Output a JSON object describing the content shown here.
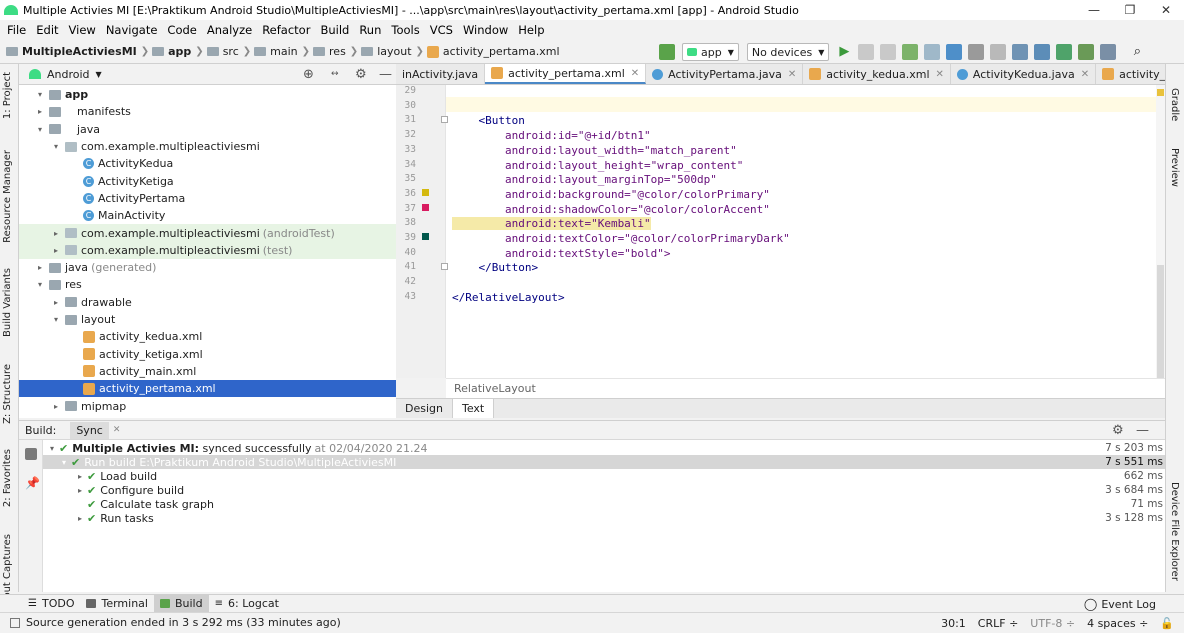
{
  "window": {
    "title": "Multiple Activies MI [E:\\Praktikum Android Studio\\MultipleActiviesMI] - ...\\app\\src\\main\\res\\layout\\activity_pertama.xml [app] - Android Studio",
    "min": "—",
    "max": "❐",
    "close": "✕"
  },
  "menu": [
    "File",
    "Edit",
    "View",
    "Navigate",
    "Code",
    "Analyze",
    "Refactor",
    "Build",
    "Run",
    "Tools",
    "VCS",
    "Window",
    "Help"
  ],
  "breadcrumb": [
    "MultipleActiviesMI",
    "app",
    "src",
    "main",
    "res",
    "layout",
    "activity_pertama.xml"
  ],
  "toolbar": {
    "config": "app",
    "device": "No devices"
  },
  "project": {
    "view": "Android",
    "rows": [
      {
        "label": "app",
        "extra": "",
        "arrow": "▾",
        "icon": "folder"
      },
      {
        "label": "manifests",
        "extra": "",
        "arrow": "▸",
        "icon": "folder"
      },
      {
        "label": "java",
        "extra": "",
        "arrow": "▾",
        "icon": "folder"
      },
      {
        "label": "com.example.multipleactiviesmi",
        "extra": "",
        "arrow": "▾",
        "icon": "pkg"
      },
      {
        "label": "ActivityKedua",
        "extra": "",
        "arrow": "",
        "icon": "cls"
      },
      {
        "label": "ActivityKetiga",
        "extra": "",
        "arrow": "",
        "icon": "cls"
      },
      {
        "label": "ActivityPertama",
        "extra": "",
        "arrow": "",
        "icon": "cls"
      },
      {
        "label": "MainActivity",
        "extra": "",
        "arrow": "",
        "icon": "cls"
      },
      {
        "label": "com.example.multipleactiviesmi",
        "extra": "(androidTest)",
        "arrow": "▸",
        "icon": "pkg"
      },
      {
        "label": "com.example.multipleactiviesmi",
        "extra": "(test)",
        "arrow": "▸",
        "icon": "pkg"
      },
      {
        "label": "java",
        "extra": "(generated)",
        "arrow": "▸",
        "icon": "folder"
      },
      {
        "label": "res",
        "extra": "",
        "arrow": "▾",
        "icon": "folder"
      },
      {
        "label": "drawable",
        "extra": "",
        "arrow": "▸",
        "icon": "folder"
      },
      {
        "label": "layout",
        "extra": "",
        "arrow": "▾",
        "icon": "folder"
      },
      {
        "label": "activity_kedua.xml",
        "extra": "",
        "arrow": "",
        "icon": "xml"
      },
      {
        "label": "activity_ketiga.xml",
        "extra": "",
        "arrow": "",
        "icon": "xml"
      },
      {
        "label": "activity_main.xml",
        "extra": "",
        "arrow": "",
        "icon": "xml"
      },
      {
        "label": "activity_pertama.xml",
        "extra": "",
        "arrow": "",
        "icon": "xml"
      },
      {
        "label": "mipmap",
        "extra": "",
        "arrow": "▸",
        "icon": "folder"
      }
    ]
  },
  "tabs": [
    {
      "label": "inActivity.java",
      "icon": "cls"
    },
    {
      "label": "activity_pertama.xml",
      "icon": "xml"
    },
    {
      "label": "ActivityPertama.java",
      "icon": "cls"
    },
    {
      "label": "activity_kedua.xml",
      "icon": "xml"
    },
    {
      "label": "ActivityKedua.java",
      "icon": "cls"
    },
    {
      "label": "activity_ketiga.xml",
      "icon": "xml"
    }
  ],
  "editor": {
    "lines": [
      {
        "n": "29",
        "code": ""
      },
      {
        "n": "30",
        "code": ""
      },
      {
        "n": "31",
        "code": "    <Button"
      },
      {
        "n": "32",
        "code": "        android:id=\"@+id/btn1\""
      },
      {
        "n": "33",
        "code": "        android:layout_width=\"match_parent\""
      },
      {
        "n": "34",
        "code": "        android:layout_height=\"wrap_content\""
      },
      {
        "n": "35",
        "code": "        android:layout_marginTop=\"500dp\""
      },
      {
        "n": "36",
        "code": "        android:background=\"@color/colorPrimary\""
      },
      {
        "n": "37",
        "code": "        android:shadowColor=\"@color/colorAccent\""
      },
      {
        "n": "38",
        "code": "        android:text=\"Kembali\""
      },
      {
        "n": "39",
        "code": "        android:textColor=\"@color/colorPrimaryDark\""
      },
      {
        "n": "40",
        "code": "        android:textStyle=\"bold\">"
      },
      {
        "n": "41",
        "code": "    </Button>"
      },
      {
        "n": "42",
        "code": ""
      },
      {
        "n": "43",
        "code": "</RelativeLayout>"
      }
    ],
    "breadcrumb": "RelativeLayout",
    "design_tab": "Design",
    "text_tab": "Text"
  },
  "build": {
    "label": "Build:",
    "sync": "Sync",
    "rows": [
      {
        "title": "Multiple Activies MI:",
        "msg": "synced successfully",
        "extra": "at 02/04/2020 21.24",
        "time": "7 s 203 ms"
      },
      {
        "title": "Run build",
        "msg": "E:\\Praktikum Android Studio\\MultipleActiviesMI",
        "extra": "",
        "time": "7 s 551 ms"
      },
      {
        "title": "Load build",
        "msg": "",
        "extra": "",
        "time": "662 ms"
      },
      {
        "title": "Configure build",
        "msg": "",
        "extra": "",
        "time": "3 s 684 ms"
      },
      {
        "title": "Calculate task graph",
        "msg": "",
        "extra": "",
        "time": "71 ms"
      },
      {
        "title": "Run tasks",
        "msg": "",
        "extra": "",
        "time": "3 s 128 ms"
      }
    ]
  },
  "sidetabs_left": [
    "1: Project",
    "Resource Manager",
    "Build Variants",
    "Z: Structure",
    "2: Favorites",
    "out Captures"
  ],
  "sidetabs_right": [
    "Gradle",
    "Preview",
    "Device File Explorer"
  ],
  "toolwindows": [
    "TODO",
    "Terminal",
    "Build",
    "6: Logcat"
  ],
  "event_log": "Event Log",
  "status": {
    "message": "Source generation ended in 3 s 292 ms (33 minutes ago)",
    "position": "30:1",
    "line_sep": "CRLF ÷",
    "encoding": "UTF-8 ÷",
    "indent": "4 spaces ÷"
  },
  "colors": {
    "accent": "#2f65ca",
    "android_green": "#3ddc84"
  }
}
